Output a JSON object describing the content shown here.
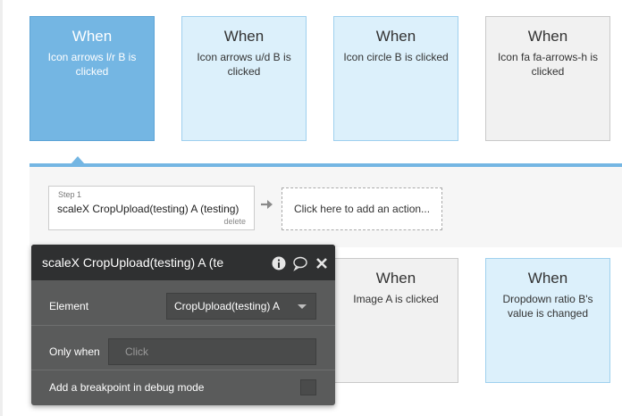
{
  "events": [
    {
      "when": "When",
      "description": "Icon arrows l/r B is clicked"
    },
    {
      "when": "When",
      "description": "Icon arrows u/d B is clicked"
    },
    {
      "when": "When",
      "description": "Icon circle B is clicked"
    },
    {
      "when": "When",
      "description": "Icon fa fa-arrows-h is clicked"
    },
    {
      "when": "When",
      "description": "Image A is clicked"
    },
    {
      "when": "When",
      "description": "Dropdown ratio B's value is changed"
    }
  ],
  "workflow": {
    "step": {
      "number_label": "Step 1",
      "title": "scaleX CropUpload(testing) A (testing)",
      "delete_label": "delete"
    },
    "add_action_label": "Click here to add an action..."
  },
  "property_editor": {
    "title": "scaleX CropUpload(testing) A (te",
    "element_label": "Element",
    "element_value": "CropUpload(testing) A",
    "only_when_label": "Only when",
    "only_when_placeholder": "Click",
    "breakpoint_label": "Add a breakpoint in debug mode"
  },
  "icons": {
    "info": "info-icon",
    "comment": "comment-icon",
    "close": "close-icon",
    "arrow": "arrow-right-icon"
  },
  "colors": {
    "selected_card": "#74b6e3",
    "light_card": "#dcf0fb",
    "grey_card": "#f1f1f1",
    "editor_bg": "#5a5b5b",
    "editor_header": "#2f3031"
  }
}
